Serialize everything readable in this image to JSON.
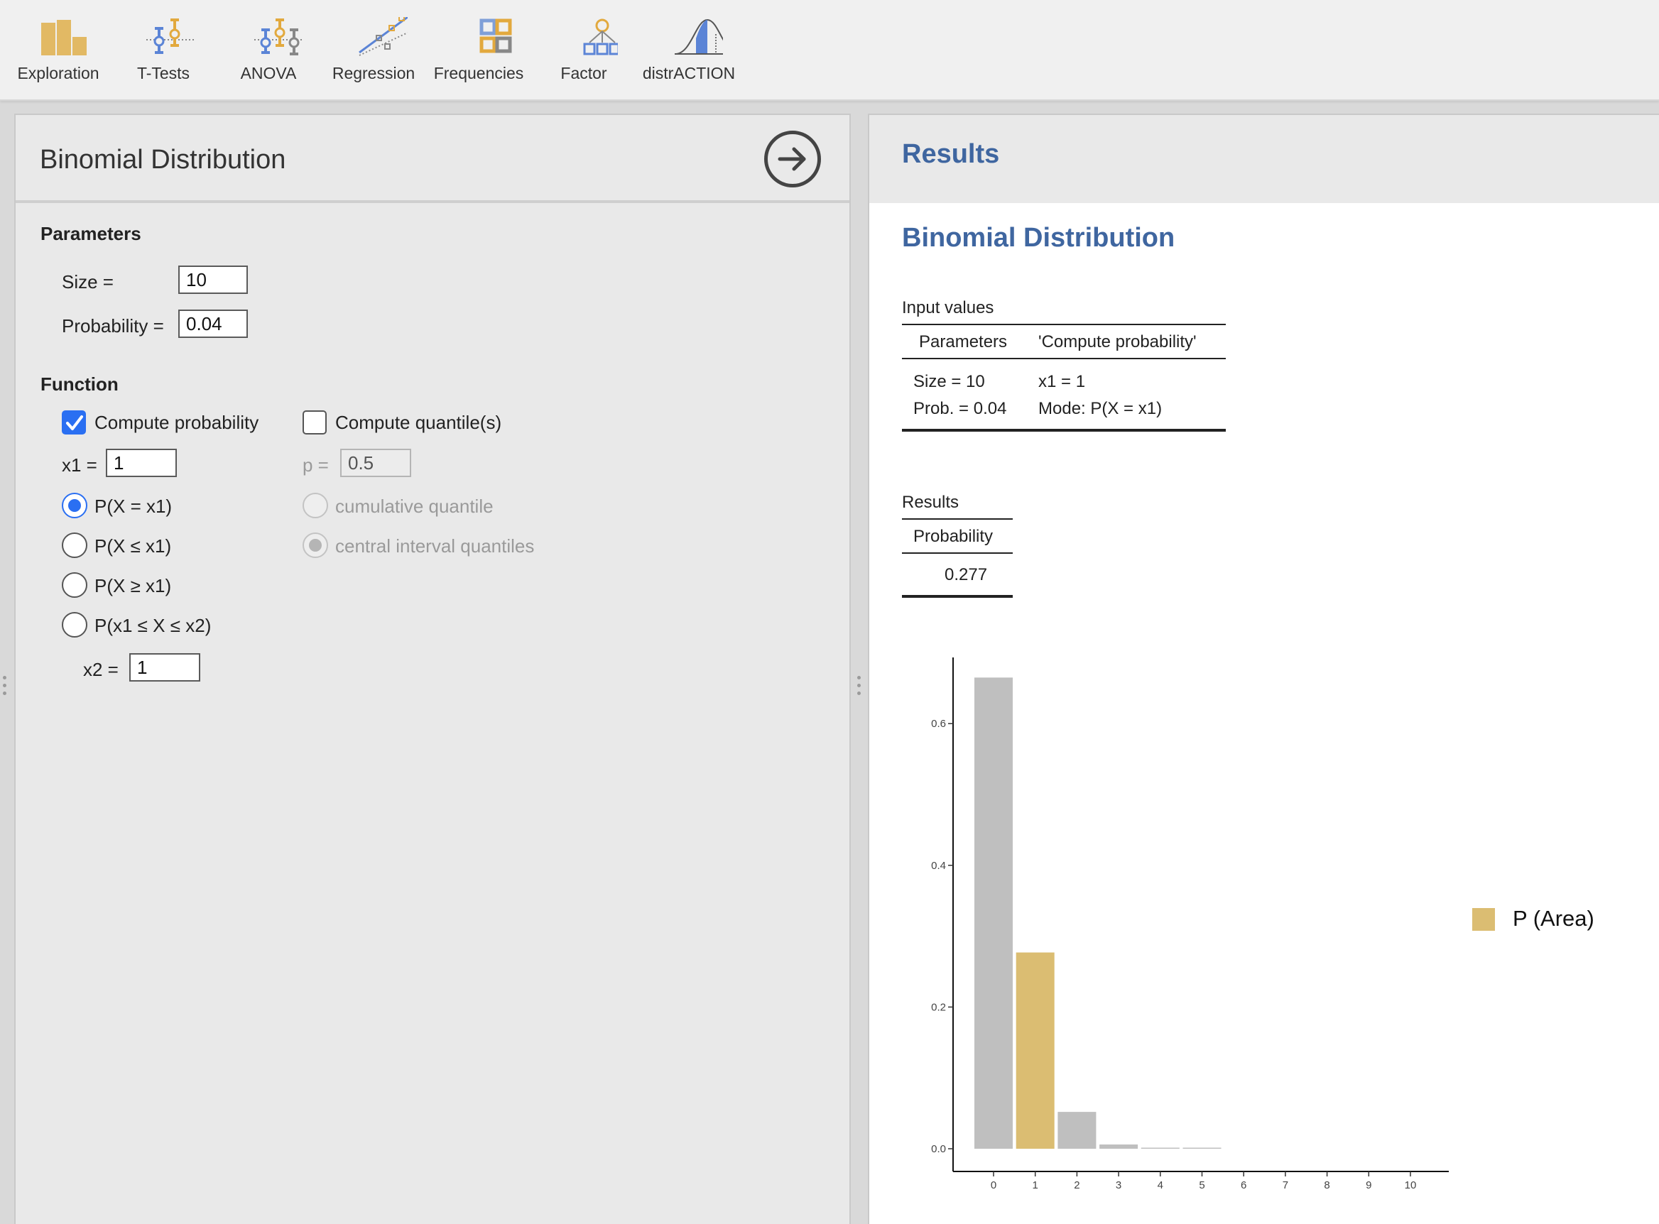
{
  "ribbon": {
    "buttons": [
      {
        "id": "exploration",
        "label": "Exploration",
        "icon": "exploration-icon"
      },
      {
        "id": "t-tests",
        "label": "T-Tests",
        "icon": "t-tests-icon"
      },
      {
        "id": "anova",
        "label": "ANOVA",
        "icon": "anova-icon"
      },
      {
        "id": "regression",
        "label": "Regression",
        "icon": "regression-icon"
      },
      {
        "id": "frequencies",
        "label": "Frequencies",
        "icon": "frequencies-icon"
      },
      {
        "id": "factor",
        "label": "Factor",
        "icon": "factor-icon"
      },
      {
        "id": "distraction",
        "label": "distrACTION",
        "icon": "distribution-icon"
      }
    ]
  },
  "options": {
    "title": "Binomial Distribution",
    "parameters_heading": "Parameters",
    "size_label": "Size =",
    "size_value": "10",
    "probability_label": "Probability =",
    "probability_value": "0.04",
    "function_heading": "Function",
    "compute_probability_label": "Compute probability",
    "compute_probability_checked": true,
    "compute_quantiles_label": "Compute quantile(s)",
    "compute_quantiles_checked": false,
    "x1_label": "x1 =",
    "x1_value": "1",
    "p_label": "p =",
    "p_value": "0.5",
    "prob_modes": [
      "P(X = x1)",
      "P(X ≤ x1)",
      "P(X ≥ x1)",
      "P(x1 ≤ X ≤ x2)"
    ],
    "prob_mode_selected": "P(X = x1)",
    "quantile_modes": [
      "cumulative quantile",
      "central interval quantiles"
    ],
    "quantile_mode_selected": "central interval quantiles",
    "x2_label": "x2 =",
    "x2_value": "1"
  },
  "results": {
    "panel_title": "Results",
    "analysis_title": "Binomial Distribution",
    "input_table": {
      "caption": "Input values",
      "headers": [
        "Parameters",
        "'Compute probability'"
      ],
      "rows": [
        [
          "Size = 10",
          "x1 = 1"
        ],
        [
          "Prob. = 0.04",
          "Mode: P(X = x1)"
        ]
      ]
    },
    "results_table": {
      "caption": "Results",
      "headers": [
        "Probability"
      ],
      "rows": [
        [
          "0.277"
        ]
      ]
    }
  },
  "chart_data": {
    "type": "bar",
    "categories": [
      "0",
      "1",
      "2",
      "3",
      "4",
      "5",
      "6",
      "7",
      "8",
      "9",
      "10"
    ],
    "values": [
      0.665,
      0.277,
      0.052,
      0.006,
      0.0004,
      2e-05,
      0,
      0,
      0,
      0,
      0
    ],
    "highlighted_category": "1",
    "ylim": [
      0,
      0.7
    ],
    "yticks": [
      "0.0",
      "0.2",
      "0.4",
      "0.6"
    ],
    "ytick_values": [
      0,
      0.2,
      0.4,
      0.6
    ],
    "legend": {
      "label": "P (Area)",
      "placement": "right"
    },
    "colors": {
      "default": "#bfbfbf",
      "highlight": "#dbbd72"
    },
    "grid": false
  }
}
